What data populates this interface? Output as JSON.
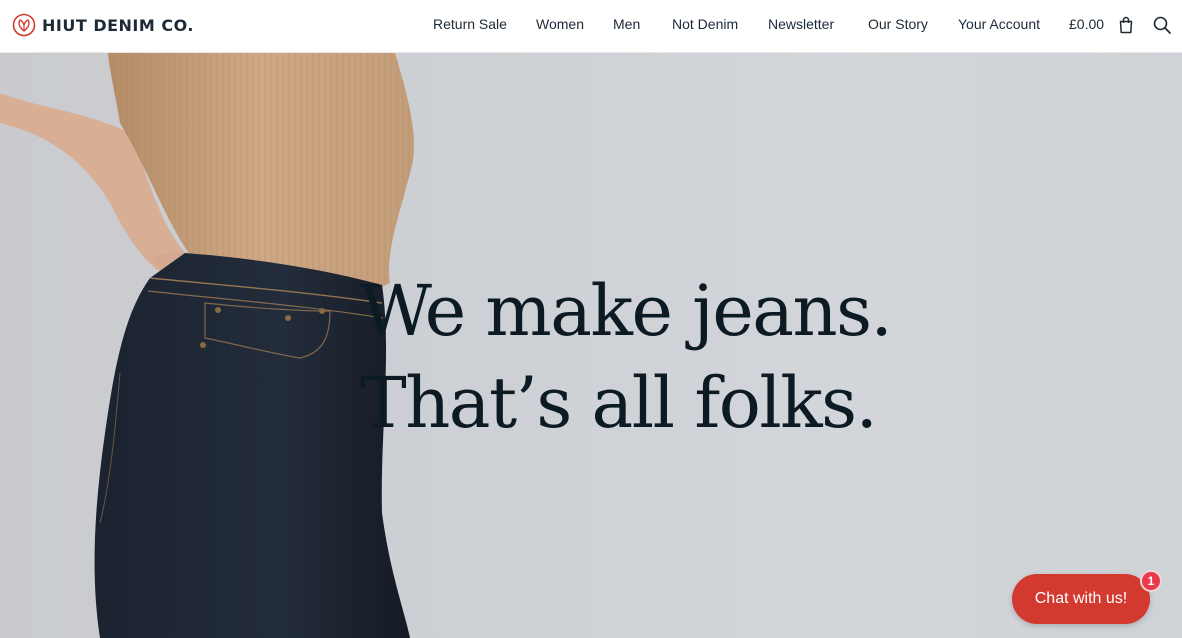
{
  "brand": {
    "name": "HIUT DENIM CO.",
    "logo_icon": "leaf-heart-icon",
    "accent_color": "#d23a30"
  },
  "nav": {
    "items": [
      {
        "label": "Return Sale"
      },
      {
        "label": "Women"
      },
      {
        "label": "Men"
      },
      {
        "label": "Not Denim"
      },
      {
        "label": "Newsletter"
      },
      {
        "label": "Our Story"
      },
      {
        "label": "Your Account"
      }
    ],
    "cart_total": "£0.00",
    "cart_icon": "shopping-bag-icon",
    "search_icon": "search-icon"
  },
  "hero": {
    "line1": "We make jeans.",
    "line2": "That’s all folks."
  },
  "chat": {
    "label": "Chat with us!",
    "badge_count": "1",
    "color": "#d23a30"
  }
}
